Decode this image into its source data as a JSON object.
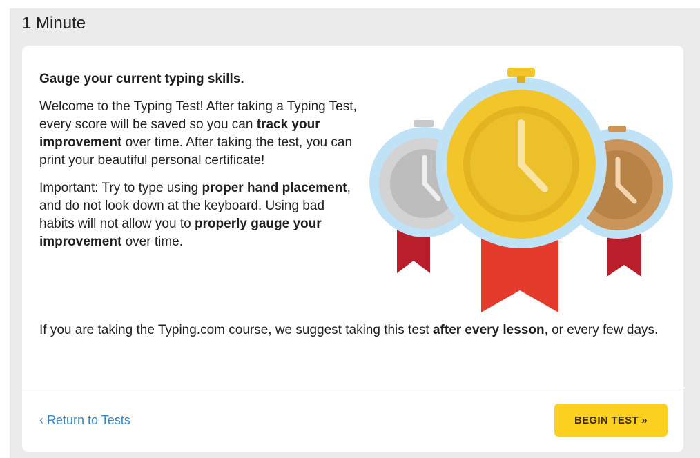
{
  "page": {
    "title": "1 Minute"
  },
  "intro": {
    "heading": "Gauge your current typing skills.",
    "p1_a": "Welcome to the Typing Test! After taking a Typing Test, every score will be saved so you can ",
    "p1_b": "track your improvement",
    "p1_c": " over time. After taking the test, you can print your beautiful personal certificate!",
    "p2_a": "Important: Try to type using ",
    "p2_b": "proper hand placement",
    "p2_c": ", and do not look down at the keyboard. Using bad habits will not allow you to ",
    "p2_d": "properly gauge your improvement",
    "p2_e": " over time.",
    "p3_a": "If you are taking the Typing.com course, we suggest taking this test ",
    "p3_b": "after every lesson",
    "p3_c": ", or every few days."
  },
  "footer": {
    "return_label": "‹ Return to Tests",
    "begin_label": "BEGIN TEST »"
  },
  "illustration": {
    "icons": [
      "silver-medal-icon",
      "gold-medal-icon",
      "bronze-medal-icon"
    ],
    "colors": {
      "gold": "#f2c52a",
      "silver": "#c9c9c9",
      "bronze": "#c9955b",
      "ribbon": "#e53b2c",
      "ribbon_dark": "#b81f2a",
      "badge_edge": "#bfe2f7"
    }
  }
}
